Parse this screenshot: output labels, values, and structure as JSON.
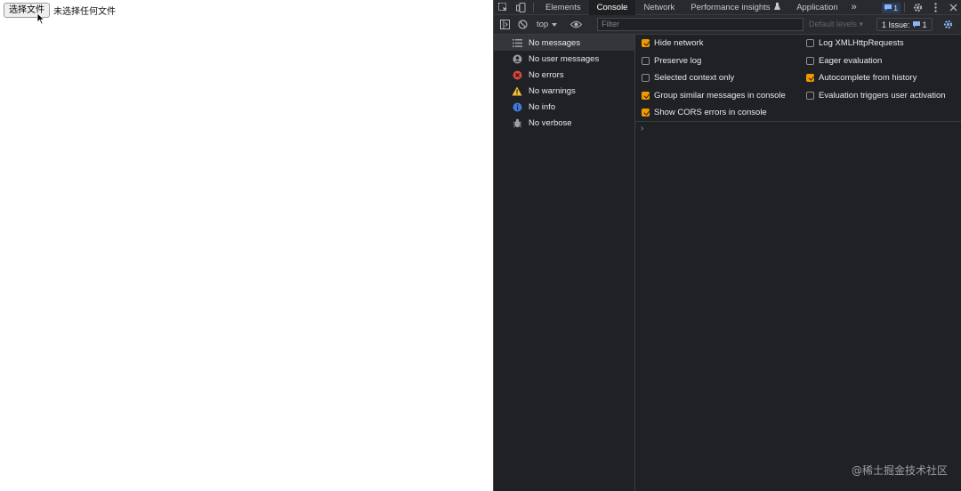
{
  "page": {
    "file_button_label": "选择文件",
    "file_status": "未选择任何文件"
  },
  "devtools": {
    "tabs": [
      {
        "label": "Elements"
      },
      {
        "label": "Console"
      },
      {
        "label": "Network"
      },
      {
        "label": "Performance insights"
      },
      {
        "label": "Application"
      }
    ],
    "active_tab": "Console",
    "more_tabs_icon": "chevron-double-right-icon",
    "messages_badge_count": "1",
    "context_selector": "top",
    "filter_placeholder": "Filter",
    "levels_label": "Default levels",
    "issues_label": "1 Issue:",
    "issues_count": "1",
    "sidebar": [
      {
        "label": "No messages",
        "icon": "list-icon",
        "selected": true
      },
      {
        "label": "No user messages",
        "icon": "user-icon",
        "selected": false
      },
      {
        "label": "No errors",
        "icon": "error-icon",
        "selected": false
      },
      {
        "label": "No warnings",
        "icon": "warning-icon",
        "selected": false
      },
      {
        "label": "No info",
        "icon": "info-icon",
        "selected": false
      },
      {
        "label": "No verbose",
        "icon": "bug-icon",
        "selected": false
      }
    ],
    "settings_left": [
      {
        "label": "Hide network",
        "checked": true
      },
      {
        "label": "Preserve log",
        "checked": false
      },
      {
        "label": "Selected context only",
        "checked": false
      },
      {
        "label": "Group similar messages in console",
        "checked": true
      },
      {
        "label": "Show CORS errors in console",
        "checked": true
      }
    ],
    "settings_right": [
      {
        "label": "Log XMLHttpRequests",
        "checked": false
      },
      {
        "label": "Eager evaluation",
        "checked": false
      },
      {
        "label": "Autocomplete from history",
        "checked": true
      },
      {
        "label": "Evaluation triggers user activation",
        "checked": false
      }
    ],
    "prompt_symbol": "›"
  },
  "watermark": "@稀土掘金技术社区",
  "colors": {
    "accent_checkbox": "#f29900",
    "error": "#e0443e",
    "warning": "#f2c12e",
    "info": "#3b7be0",
    "devtools_bg": "#202124"
  }
}
